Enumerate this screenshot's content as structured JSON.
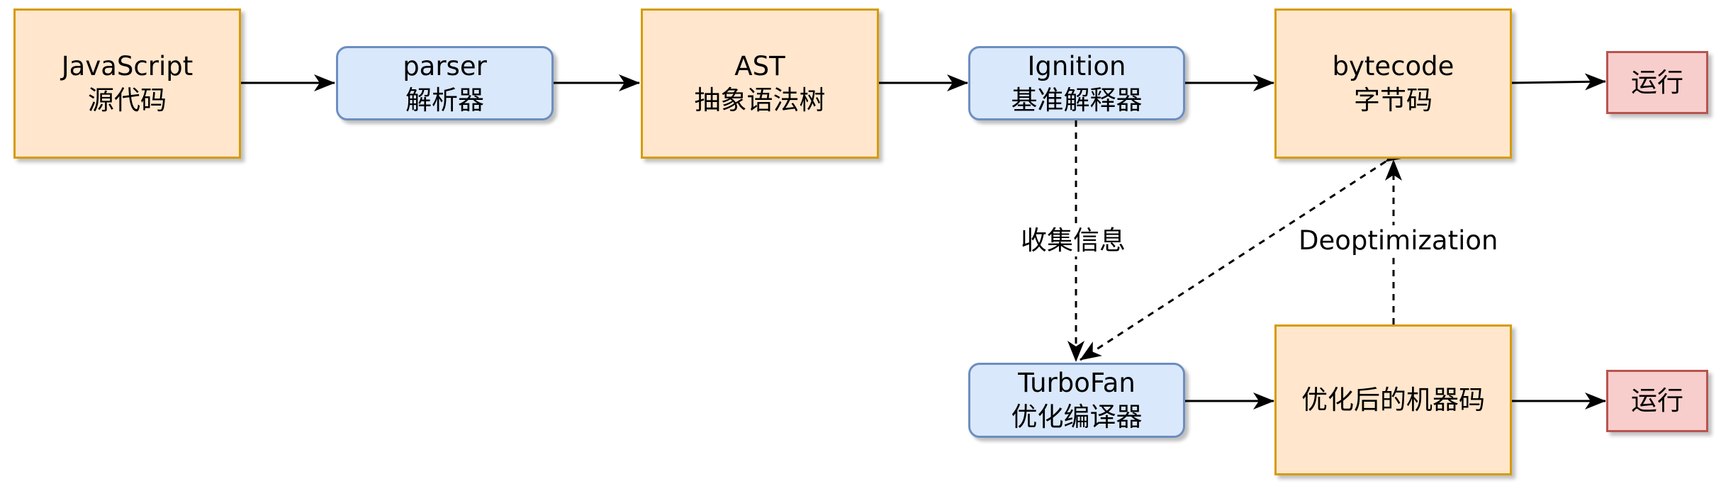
{
  "nodes": {
    "js_source": {
      "line1": "JavaScript",
      "line2": "源代码"
    },
    "parser": {
      "line1": "parser",
      "line2": "解析器"
    },
    "ast": {
      "line1": "AST",
      "line2": "抽象语法树"
    },
    "ignition": {
      "line1": "Ignition",
      "line2": "基准解释器"
    },
    "bytecode": {
      "line1": "bytecode",
      "line2": "字节码"
    },
    "run_top": {
      "text": "运行"
    },
    "turbofan": {
      "line1": "TurboFan",
      "line2": "优化编译器"
    },
    "optimized": {
      "text": "优化后的机器码"
    },
    "run_bottom": {
      "text": "运行"
    }
  },
  "edges": {
    "collect_info": "收集信息",
    "deoptimization": "Deoptimization"
  },
  "colors": {
    "orange_fill": "#ffe6cc",
    "orange_stroke": "#d79b00",
    "blue_fill": "#dae8fc",
    "blue_stroke": "#6c8ebf",
    "red_fill": "#f8cecc",
    "red_stroke": "#b85450"
  }
}
